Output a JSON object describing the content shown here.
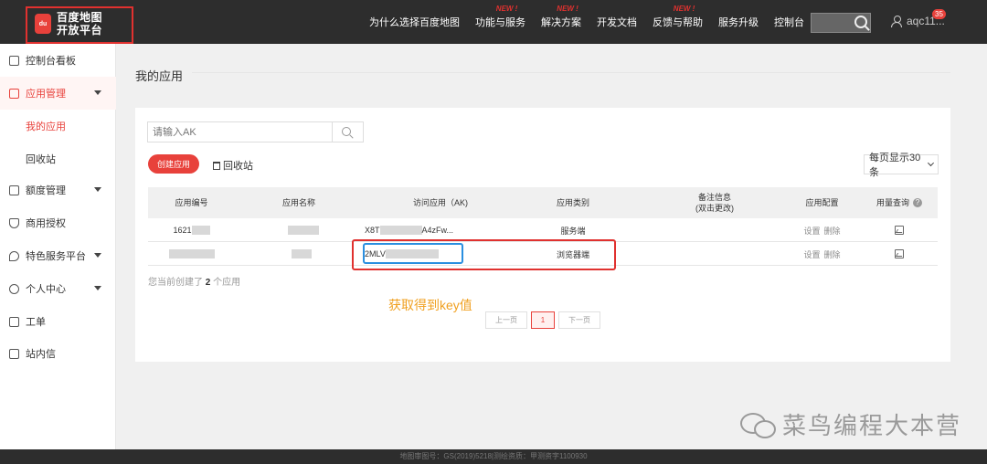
{
  "header": {
    "logo_line1": "百度地图",
    "logo_line2": "开放平台",
    "logo_pin": "du",
    "nav": [
      {
        "label": "为什么选择百度地图",
        "new": ""
      },
      {
        "label": "功能与服务",
        "new": "NEW !"
      },
      {
        "label": "解决方案",
        "new": "NEW !"
      },
      {
        "label": "开发文档",
        "new": ""
      },
      {
        "label": "反馈与帮助",
        "new": "NEW !"
      },
      {
        "label": "服务升级",
        "new": ""
      },
      {
        "label": "控制台",
        "new": ""
      }
    ],
    "username": "aqc11...",
    "badge": "35"
  },
  "sidebar": {
    "items": [
      {
        "label": "控制台看板"
      },
      {
        "label": "应用管理"
      },
      {
        "label": "我的应用"
      },
      {
        "label": "回收站"
      },
      {
        "label": "额度管理"
      },
      {
        "label": "商用授权"
      },
      {
        "label": "特色服务平台"
      },
      {
        "label": "个人中心"
      },
      {
        "label": "工单"
      },
      {
        "label": "站内信"
      }
    ]
  },
  "main": {
    "title": "我的应用",
    "search_placeholder": "请输入AK",
    "create_label": "创建应用",
    "recycle_label": "回收站",
    "per_page": "每页显示30条",
    "columns": [
      "应用编号",
      "应用名称",
      "访问应用（AK)",
      "应用类别",
      "备注信息",
      "(双击更改)",
      "应用配置",
      "用量查询"
    ],
    "rows": [
      {
        "id": "1621",
        "ak_start": "X8T",
        "ak_end": "A4zFw...",
        "category": "服务端",
        "settings": "设置",
        "delete": "删除"
      },
      {
        "id": "",
        "ak_start": "2MLV",
        "ak_end": "",
        "category": "浏览器端",
        "settings": "设置",
        "delete": "删除"
      }
    ],
    "count_prefix": "您当前创建了",
    "count": "2",
    "count_suffix": "个应用",
    "annotation": "获取得到key值",
    "pager": {
      "prev": "上一页",
      "current": "1",
      "next": "下一页"
    },
    "help_icon": "?"
  },
  "watermark": "菜鸟编程大本营",
  "footer": "地图审图号：GS(2019)5218|测绘资质：甲测资字1100930"
}
